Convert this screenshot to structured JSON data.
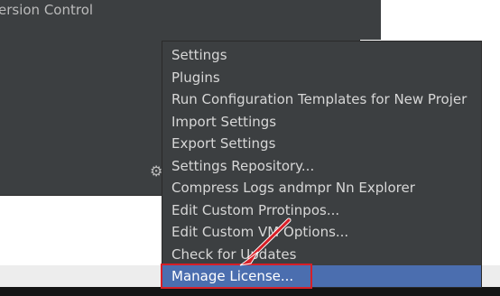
{
  "panel": {
    "title": "ersion Control"
  },
  "menu": {
    "items": [
      {
        "label": "Settings"
      },
      {
        "label": "Plugins"
      },
      {
        "label": "Run Configuration Templates for New Projer"
      },
      {
        "label": "Import Settings"
      },
      {
        "label": "Export Settings"
      },
      {
        "label": "Settings Repository..."
      },
      {
        "label": "Compress Logs andmpr Nn Explorer"
      },
      {
        "label": "Edit Custom Prrotinpos..."
      },
      {
        "label": "Edit Custom VM Options..."
      },
      {
        "label": "Check for Updates"
      },
      {
        "label": "Manage License..."
      }
    ],
    "selected_index": 10
  },
  "icons": {
    "gear": "gear-icon",
    "arrow": "red-arrow"
  },
  "colors": {
    "panel_bg": "#3c3f41",
    "menu_text": "#d7d7d7",
    "selected_bg": "#4b6eaf",
    "annotation_red": "#d71f27"
  }
}
